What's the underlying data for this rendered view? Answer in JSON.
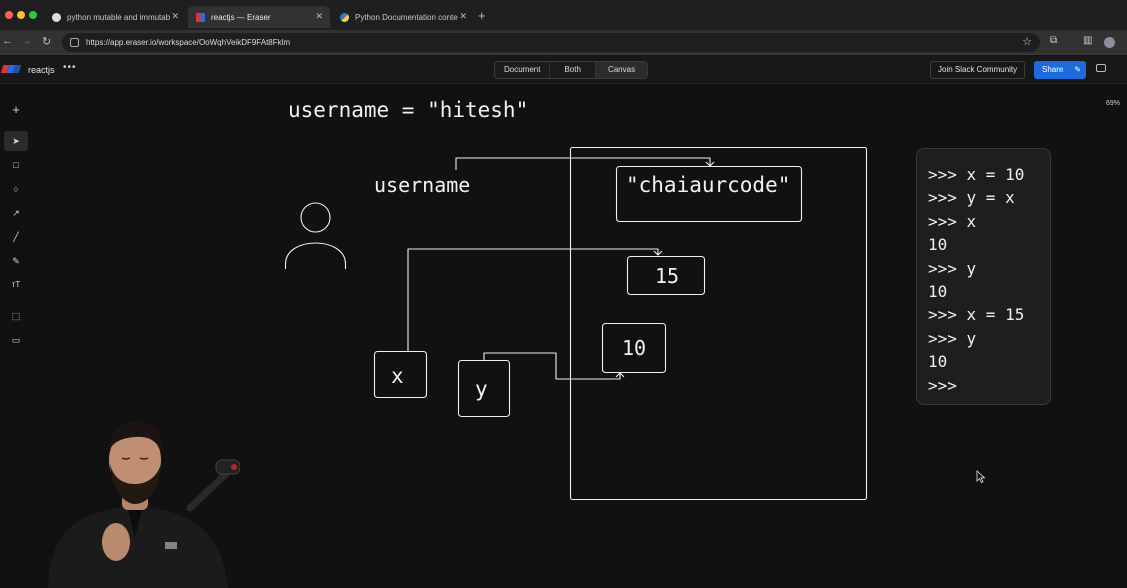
{
  "browser": {
    "tabs": [
      {
        "title": "python mutable and immutab",
        "active": false
      },
      {
        "title": "reactjs — Eraser",
        "active": true
      },
      {
        "title": "Python Documentation conte",
        "active": false
      }
    ],
    "url": "https://app.eraser.io/workspace/OoWqhVeikDF9FAt8Fklm"
  },
  "app": {
    "project_name": "reactjs",
    "view_toggle": [
      "Document",
      "Both",
      "Canvas"
    ],
    "selected_view": "Canvas",
    "slack_button": "Join Slack Community",
    "share_button": "Share",
    "zoom_level": "69%"
  },
  "canvas": {
    "assignment_text": "username = \"hitesh\"",
    "variable_label": "username",
    "string_value": "\"chaiaurcode\"",
    "value_15": "15",
    "value_10": "10",
    "var_x": "x",
    "var_y": "y"
  },
  "terminal": {
    "lines": [
      ">>> x = 10",
      ">>> y = x",
      ">>> x",
      "10",
      ">>> y",
      "10",
      ">>> x = 15",
      ">>> y",
      "10",
      ">>>"
    ]
  },
  "colors": {
    "accent": "#1e6bde",
    "canvas_bg": "#111111",
    "logo_red": "#e0352b",
    "logo_blue": "#2d6ae3"
  }
}
